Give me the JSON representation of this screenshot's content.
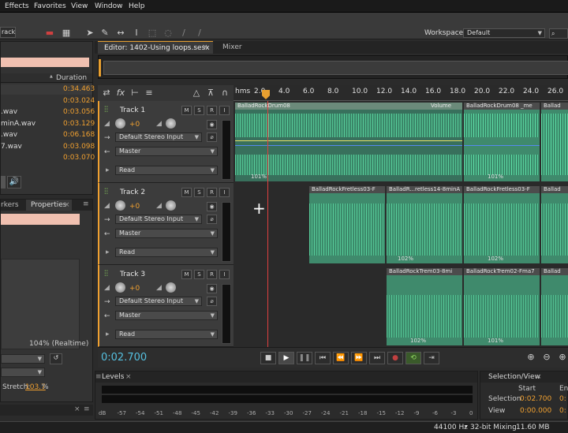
{
  "menu": {
    "effects": "Effects",
    "favorites": "Favorites",
    "view": "View",
    "window": "Window",
    "help": "Help"
  },
  "toolbar": {
    "track_label": "rack",
    "workspace_label": "Workspace:",
    "workspace_value": "Default"
  },
  "files": {
    "duration_header": "Duration",
    "durations": [
      "0:34.463",
      "0:03.024",
      "0:03.056",
      "0:03.129",
      "0:06.168",
      "0:03.098",
      "0:03.070"
    ],
    "names": [
      "",
      "",
      ".wav",
      "minA.wav",
      ".wav",
      "7.wav",
      ""
    ]
  },
  "left_tabs": {
    "markers": "rkers",
    "properties": "Properties"
  },
  "props": {
    "stretch_pct": "104%  (Realtime)",
    "stretch_label": "Stretch:",
    "stretch_value": "103.7",
    "stretch_unit": "%"
  },
  "editor": {
    "tab": "Editor: 1402-Using loops.sesx",
    "mixer": "Mixer"
  },
  "ruler": {
    "unit": "hms",
    "ticks": [
      "2.0",
      "4.0",
      "6.0",
      "8.0",
      "10.0",
      "12.0",
      "14.0",
      "16.0",
      "18.0",
      "20.0",
      "22.0",
      "24.0",
      "26.0"
    ]
  },
  "tracks": [
    {
      "name": "Track 1",
      "vol": "+0",
      "input": "Default Stereo Input",
      "output": "Master",
      "mode": "Read"
    },
    {
      "name": "Track 2",
      "vol": "+0",
      "input": "Default Stereo Input",
      "output": "Master",
      "mode": "Read"
    },
    {
      "name": "Track 3",
      "vol": "+0",
      "input": "Default Stereo Input",
      "output": "Master",
      "mode": "Read"
    }
  ],
  "track_buttons": {
    "m": "M",
    "s": "S",
    "r": "R",
    "i": "I"
  },
  "clips": {
    "t1": [
      {
        "label": "BalladRockDrum08",
        "sub": "Volume",
        "pct": "101%"
      },
      {
        "label": "BalladRockDrum08 _me",
        "pct": "101%"
      },
      {
        "label": "Ballad",
        "pct": ""
      }
    ],
    "t2": [
      {
        "label": "BalladRockFretless03-F",
        "pct": ""
      },
      {
        "label": "BalladR...retless14-8minA",
        "pct": "102%"
      },
      {
        "label": "BalladRockFretless03-F",
        "pct": "102%"
      },
      {
        "label": "Ballad",
        "pct": ""
      }
    ],
    "t3": [
      {
        "label": "BalladRockTrem03-8mi",
        "pct": "102%"
      },
      {
        "label": "BalladRockTrem02-Fma7",
        "pct": "101%"
      },
      {
        "label": "Ballad",
        "pct": ""
      }
    ]
  },
  "transport": {
    "time": "0:02.700"
  },
  "levels": {
    "title": "Levels",
    "scale": [
      "dB",
      "-57",
      "-54",
      "-51",
      "-48",
      "-45",
      "-42",
      "-39",
      "-36",
      "-33",
      "-30",
      "-27",
      "-24",
      "-21",
      "-18",
      "-15",
      "-12",
      "-9",
      "-6",
      "-3",
      "0"
    ]
  },
  "selview": {
    "title": "Selection/View",
    "start": "Start",
    "end": "En",
    "selection": "Selection",
    "view": "View",
    "sel_start": "0:02.700",
    "view_start": "0:00.000",
    "sel_end": "0:",
    "view_end": "0:"
  },
  "status": {
    "rate": "44100 Hz",
    "bits": "32-bit Mixing",
    "mem": "11.60 MB"
  }
}
